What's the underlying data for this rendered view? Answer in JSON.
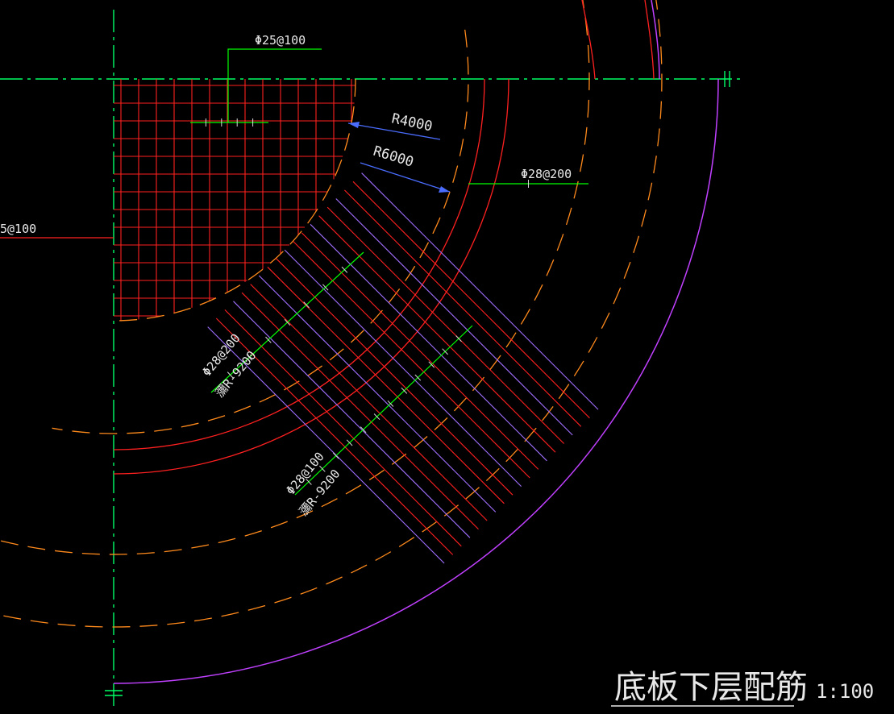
{
  "drawing": {
    "title": "底板下层配筋",
    "scale": "1:100"
  },
  "labels": {
    "top_mesh": "Φ25@100",
    "left_mesh": "5@100",
    "r4000": "R4000",
    "r6000": "R6000",
    "ring_bar": "Φ28@200",
    "radial_200": "Φ28@200",
    "radial_200_len": "瀰R-9200",
    "radial_100": "Φ28@100",
    "radial_100_len": "瀰R-9200"
  },
  "colors": {
    "background": "#000000",
    "centerline": "#00ff66",
    "rebar": "#ff2020",
    "dashed": "#ff8a1c",
    "outline": "#c040ff",
    "leader": "#00ff00",
    "dimension": "#4a6dff",
    "text": "#e8e8e8",
    "diagonal": "#a070ff"
  }
}
